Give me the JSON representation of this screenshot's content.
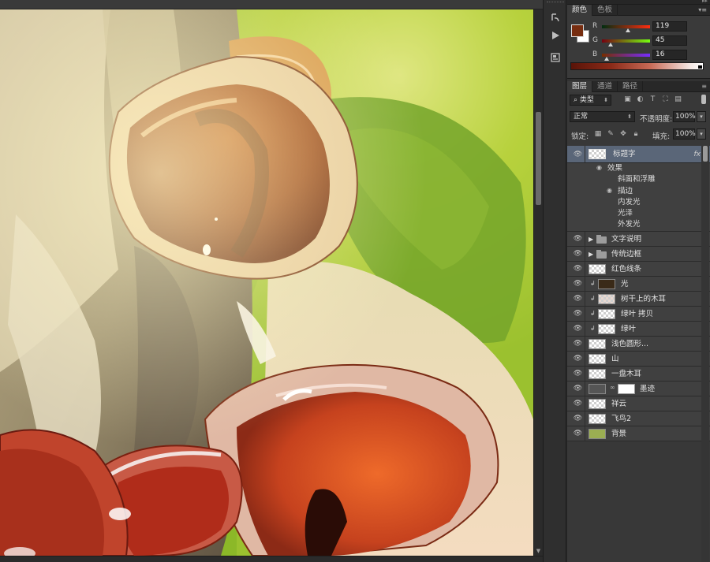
{
  "color_panel": {
    "tabs": [
      "颜色",
      "色板"
    ],
    "fg_color": "#772D10",
    "bg_color": "#FFFFFF",
    "channels": [
      {
        "label": "R",
        "value": "119",
        "gradient": "linear-gradient(to right,#002d10,#ff2d10)"
      },
      {
        "label": "G",
        "value": "45",
        "gradient": "linear-gradient(to right,#770010,#77ff10)"
      },
      {
        "label": "B",
        "value": "16",
        "gradient": "linear-gradient(to right,#772d00,#772dff)"
      }
    ]
  },
  "layers_panel": {
    "tabs": [
      "图层",
      "通道",
      "路径"
    ],
    "filter_type": "类型",
    "blend_mode": "正常",
    "opacity_label": "不透明度:",
    "opacity_value": "100%",
    "lock_label": "锁定:",
    "fill_label": "填充:",
    "fill_value": "100%",
    "selected_layer": {
      "name": "标题字",
      "fx": "fx"
    },
    "effects_label": "效果",
    "effects": [
      "斜面和浮雕",
      "描边",
      "内发光",
      "光泽",
      "外发光"
    ],
    "layers": [
      {
        "name": "文字说明",
        "kind": "group"
      },
      {
        "name": "传统边框",
        "kind": "group"
      },
      {
        "name": "红色线条",
        "kind": "layer"
      },
      {
        "name": "光",
        "kind": "clipped"
      },
      {
        "name": "树干上的木耳",
        "kind": "clipped"
      },
      {
        "name": "绿叶 拷贝",
        "kind": "clipped"
      },
      {
        "name": "绿叶",
        "kind": "clipped"
      },
      {
        "name": "浅色圆形...",
        "kind": "layer"
      },
      {
        "name": "山",
        "kind": "layer"
      },
      {
        "name": "一盘木耳",
        "kind": "layer"
      },
      {
        "name": "墨迹",
        "kind": "masked"
      },
      {
        "name": "祥云",
        "kind": "layer"
      },
      {
        "name": "飞鸟2",
        "kind": "layer"
      },
      {
        "name": "背景",
        "kind": "background"
      }
    ]
  },
  "icons": {
    "menu": "panel-menu-icon",
    "visibility": "eye-icon",
    "tools": [
      "history-brush-icon",
      "play-action-icon",
      "properties-icon"
    ]
  },
  "background_layer_color": "#9BAE52"
}
